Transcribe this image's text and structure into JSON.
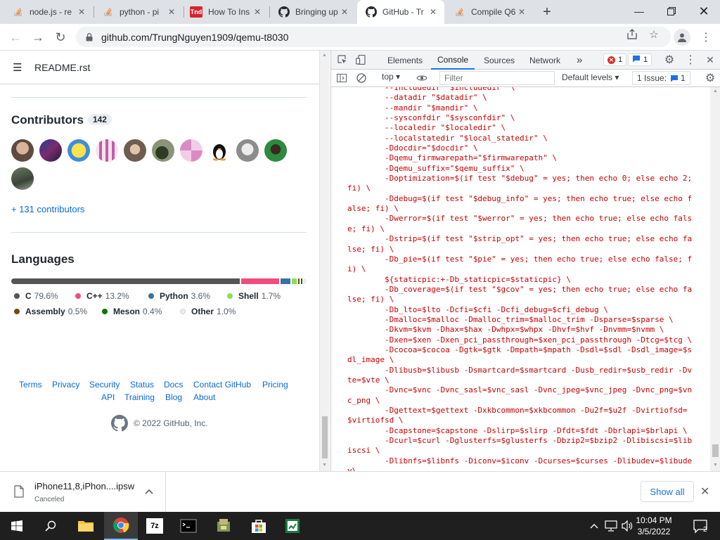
{
  "browser": {
    "tabs": [
      {
        "title": "node.js - re",
        "icon": "stackoverflow-icon",
        "active": false
      },
      {
        "title": "python - pi",
        "icon": "stackoverflow-icon",
        "active": false
      },
      {
        "title": "How To Ins",
        "icon": "tnd-icon",
        "favicon_text": "Tnd",
        "active": false
      },
      {
        "title": "Bringing up",
        "icon": "github-icon",
        "active": false
      },
      {
        "title": "GitHub - Tr",
        "icon": "github-icon",
        "active": true
      },
      {
        "title": "Compile Q6",
        "icon": "stackoverflow-icon",
        "active": false
      }
    ],
    "url": "github.com/TrungNguyen1909/qemu-t8030"
  },
  "github": {
    "readme_filename": "README.rst",
    "contributors": {
      "heading": "Contributors",
      "count": "142",
      "more_link": "+ 131 contributors"
    },
    "languages": {
      "heading": "Languages",
      "items": [
        {
          "name": "C",
          "percent": "79.6%",
          "color": "#555555",
          "value": 79.6
        },
        {
          "name": "C++",
          "percent": "13.2%",
          "color": "#f34b7d",
          "value": 13.2
        },
        {
          "name": "Python",
          "percent": "3.6%",
          "color": "#3572A5",
          "value": 3.6
        },
        {
          "name": "Shell",
          "percent": "1.7%",
          "color": "#89e051",
          "value": 1.7
        },
        {
          "name": "Assembly",
          "percent": "0.5%",
          "color": "#6E4C13",
          "value": 0.5
        },
        {
          "name": "Meson",
          "percent": "0.4%",
          "color": "#007800",
          "value": 0.4
        },
        {
          "name": "Other",
          "percent": "1.0%",
          "color": "#ededed",
          "value": 1.0
        }
      ]
    },
    "footer": {
      "links_row1": [
        "Terms",
        "Privacy",
        "Security",
        "Status",
        "Docs",
        "Contact GitHub",
        "Pricing"
      ],
      "links_row2": [
        "API",
        "Training",
        "Blog",
        "About"
      ],
      "copyright": "© 2022 GitHub, Inc."
    }
  },
  "devtools": {
    "tabs": [
      "Elements",
      "Console",
      "Sources",
      "Network"
    ],
    "active_tab": "Console",
    "more_tabs": "»",
    "error_count": "1",
    "message_count": "1",
    "context": "top",
    "filter_placeholder": "Filter",
    "levels": "Default levels",
    "issues_label": "1 Issue:",
    "issues_count": "1",
    "console_text": "        --includedir \"$includedir\" \\\n        --datadir \"$datadir\" \\\n        --mandir \"$mandir\" \\\n        --sysconfdir \"$sysconfdir\" \\\n        --localedir \"$localedir\" \\\n        --localstatedir \"$local_statedir\" \\\n        -Ddocdir=\"$docdir\" \\\n        -Dqemu_firmwarepath=\"$firmwarepath\" \\\n        -Dqemu_suffix=\"$qemu_suffix\" \\\n        -Doptimization=$(if test \"$debug\" = yes; then echo 0; else echo 2; fi) \\\n        -Ddebug=$(if test \"$debug_info\" = yes; then echo true; else echo false; fi) \\\n        -Dwerror=$(if test \"$werror\" = yes; then echo true; else echo false; fi) \\\n        -Dstrip=$(if test \"$strip_opt\" = yes; then echo true; else echo false; fi) \\\n        -Db_pie=$(if test \"$pie\" = yes; then echo true; else echo false; fi) \\\n        ${staticpic:+-Db_staticpic=$staticpic} \\\n        -Db_coverage=$(if test \"$gcov\" = yes; then echo true; else echo false; fi) \\\n        -Db_lto=$lto -Dcfi=$cfi -Dcfi_debug=$cfi_debug \\\n        -Dmalloc=$malloc -Dmalloc_trim=$malloc_trim -Dsparse=$sparse \\\n        -Dkvm=$kvm -Dhax=$hax -Dwhpx=$whpx -Dhvf=$hvf -Dnvmm=$nvmm \\\n        -Dxen=$xen -Dxen_pci_passthrough=$xen_pci_passthrough -Dtcg=$tcg \\\n        -Dcocoa=$cocoa -Dgtk=$gtk -Dmpath=$mpath -Dsdl=$sdl -Dsdl_image=$sdl_image \\\n        -Dlibusb=$libusb -Dsmartcard=$smartcard -Dusb_redir=$usb_redir -Dvte=$vte \\\n        -Dvnc=$vnc -Dvnc_sasl=$vnc_sasl -Dvnc_jpeg=$vnc_jpeg -Dvnc_png=$vnc_png \\\n        -Dgettext=$gettext -Dxkbcommon=$xkbcommon -Du2f=$u2f -Dvirtiofsd=$virtiofsd \\\n        -Dcapstone=$capstone -Dslirp=$slirp -Dfdt=$fdt -Dbrlapi=$brlapi \\\n        -Dcurl=$curl -Dglusterfs=$glusterfs -Dbzip2=$bzip2 -Dlibiscsi=$libiscsi \\\n        -Dlibnfs=$libnfs -Diconv=$iconv -Dcurses=$curses -Dlibudev=$libudev\\"
  },
  "downloads": {
    "filename": "iPhone11,8,iPhon....ipsw",
    "status": "Canceled",
    "show_all": "Show all"
  },
  "taskbar": {
    "time": "10:04 PM",
    "date": "3/5/2022",
    "notification_count": "2"
  }
}
